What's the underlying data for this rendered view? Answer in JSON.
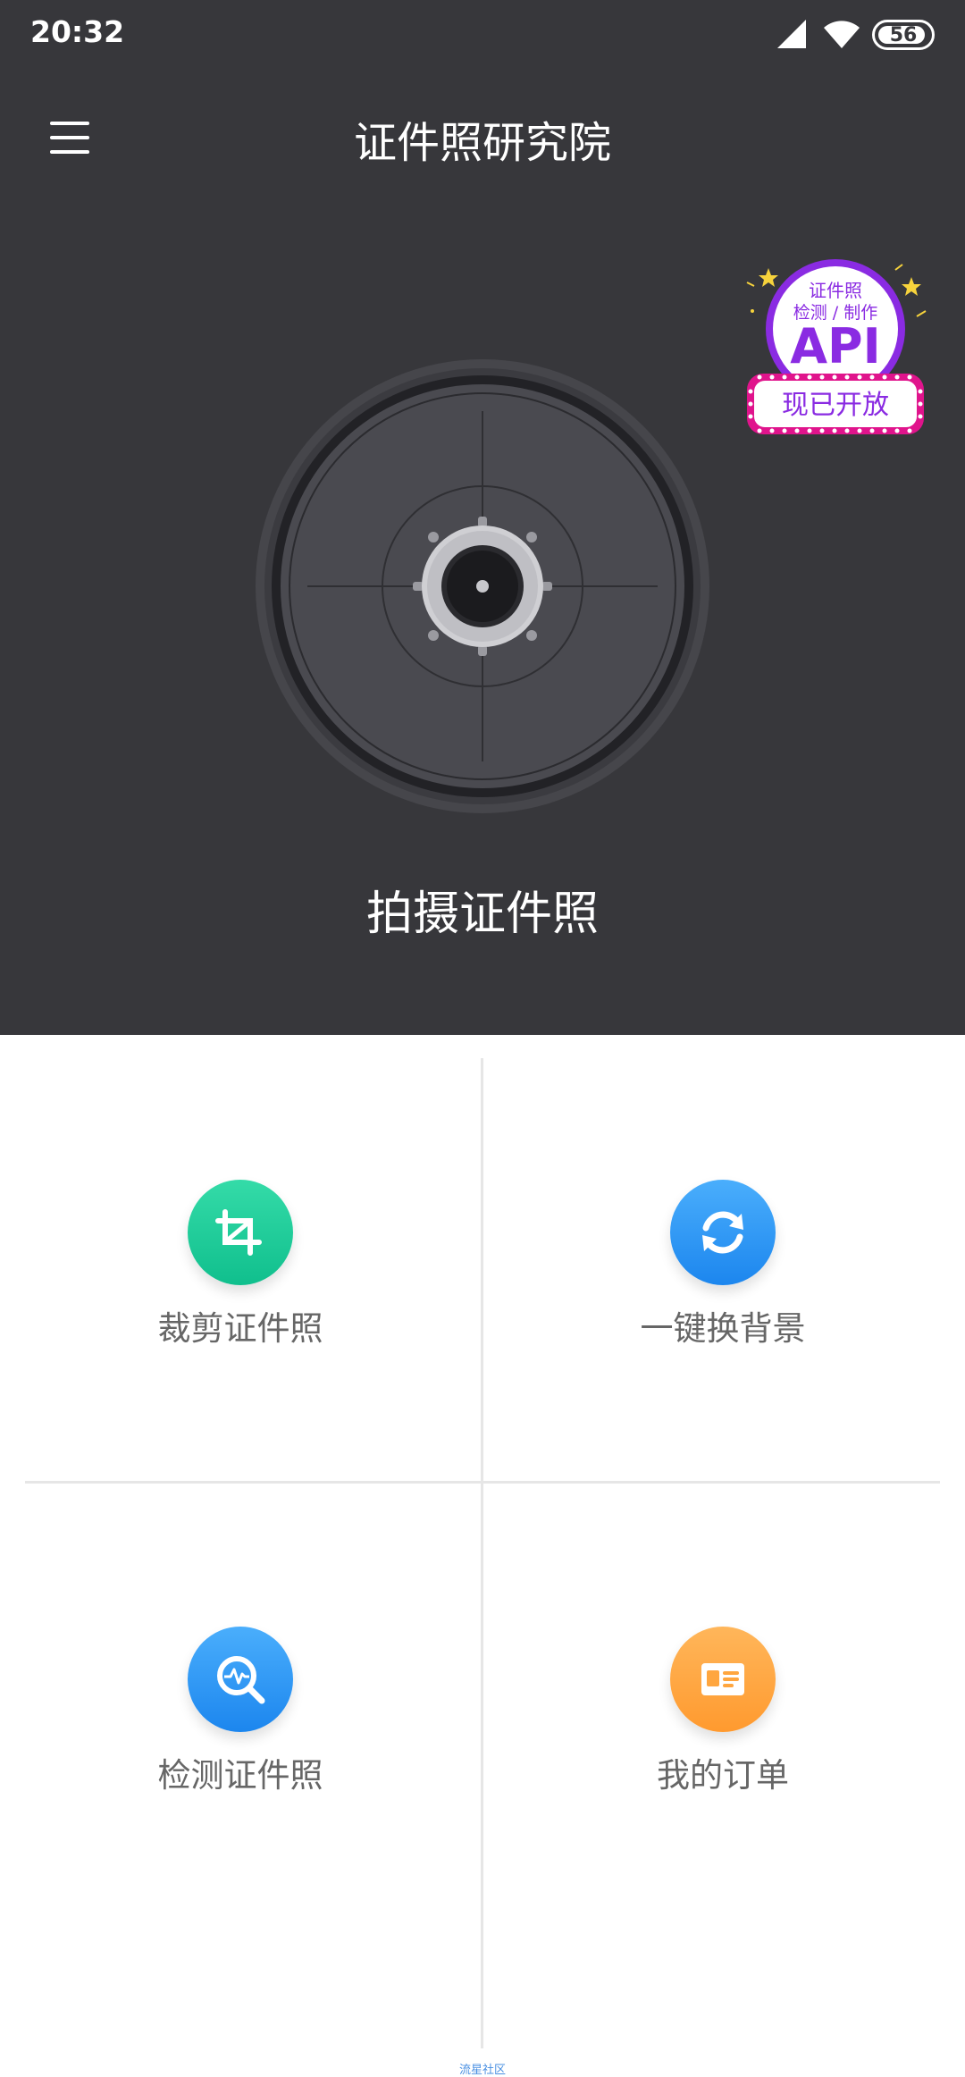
{
  "status_bar": {
    "time": "20:32",
    "battery": "56",
    "icons": [
      "signal-icon",
      "wifi-icon",
      "battery-icon"
    ]
  },
  "app_bar": {
    "title": "证件照研究院",
    "menu_icon": "hamburger-menu-icon"
  },
  "api_badge": {
    "line1": "证件照",
    "line2": "检测 / 制作",
    "line3": "API",
    "line4": "现已开放",
    "colors": {
      "purple": "#8a2be2",
      "magenta": "#e0148c"
    }
  },
  "camera": {
    "label": "拍摄证件照",
    "icon": "camera-lens-icon"
  },
  "tiles": [
    {
      "label": "裁剪证件照",
      "icon": "crop-icon",
      "color": "#1fcf9b"
    },
    {
      "label": "一键换背景",
      "icon": "refresh-icon",
      "color": "#2f97f5"
    },
    {
      "label": "检测证件照",
      "icon": "detect-search-icon",
      "color": "#2f97f5"
    },
    {
      "label": "我的订单",
      "icon": "id-card-icon",
      "color": "#ffa63f"
    }
  ],
  "watermark": "流星社区"
}
